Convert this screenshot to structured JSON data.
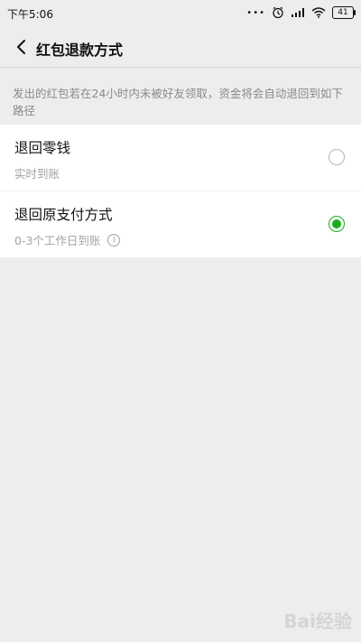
{
  "status_bar": {
    "time": "下午5:06",
    "dots": "•••",
    "battery": "41",
    "icons": [
      "alarm-icon",
      "signal-icon",
      "wifi-icon",
      "battery-icon"
    ]
  },
  "nav": {
    "back_icon": "chevron-left-icon",
    "title": "红包退款方式"
  },
  "description": "发出的红包若在24小时内未被好友领取，资金将会自动退回到如下路径",
  "options": [
    {
      "title": "退回零钱",
      "subtitle": "实时到账",
      "selected": false
    },
    {
      "title": "退回原支付方式",
      "subtitle": "0-3个工作日到账",
      "selected": true,
      "info_icon": "info-icon",
      "info_glyph": "i"
    }
  ],
  "watermark": "Bai经验",
  "colors": {
    "background": "#ededed",
    "card": "#ffffff",
    "accent_green": "#1aad19",
    "muted_text": "#a3a3a3"
  }
}
